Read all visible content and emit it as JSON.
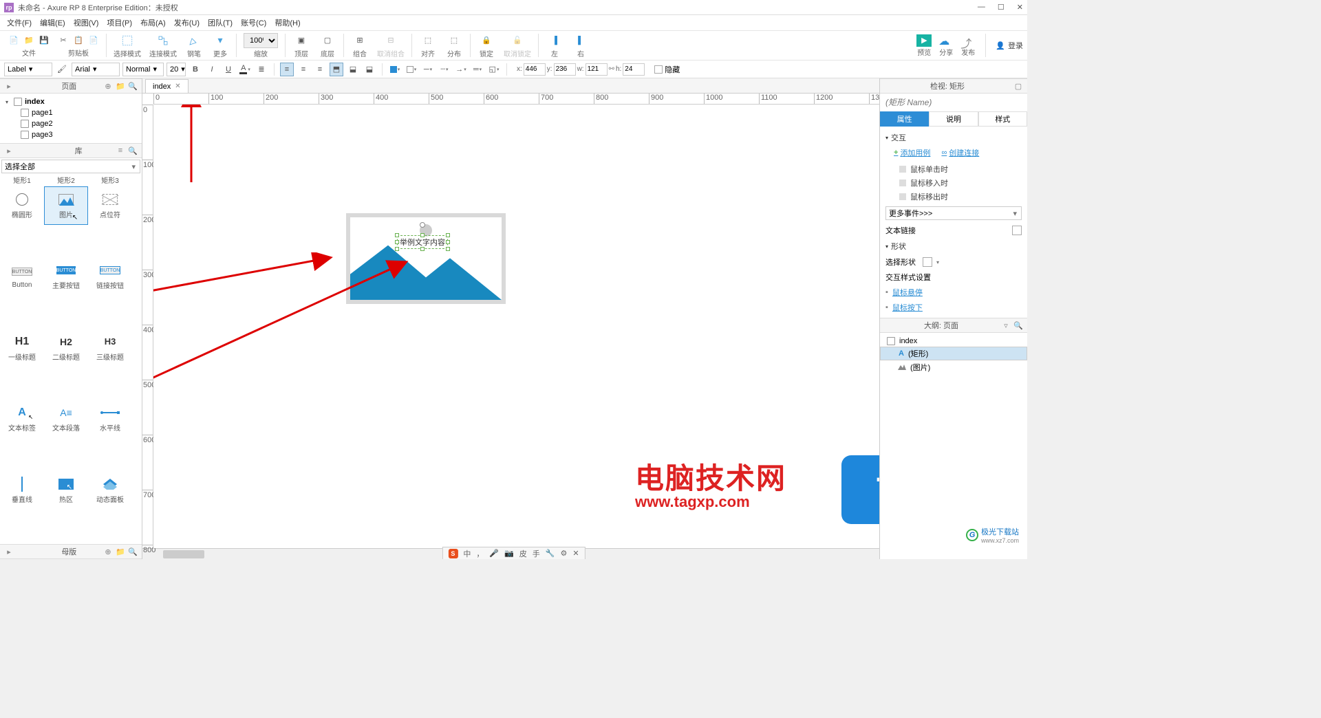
{
  "title": "未命名 - Axure RP 8 Enterprise Edition：未授权",
  "menus": [
    "文件(F)",
    "编辑(E)",
    "视图(V)",
    "项目(P)",
    "布局(A)",
    "发布(U)",
    "团队(T)",
    "账号(C)",
    "帮助(H)"
  ],
  "toolbar": {
    "group1": {
      "label": "文件"
    },
    "group2": {
      "label": "剪贴板"
    },
    "sel_mode": "选择模式",
    "conn_mode": "连接模式",
    "pen": "钢笔",
    "more": "更多",
    "zoom": "100%",
    "zoom_lbl": "缩放",
    "top": "顶层",
    "bottom": "底层",
    "group": "组合",
    "ungroup": "取消组合",
    "align": "对齐",
    "distribute": "分布",
    "lock": "锁定",
    "unlock": "取消锁定",
    "left": "左",
    "right": "右",
    "preview": "预览",
    "share": "分享",
    "publish": "发布",
    "login": "登录"
  },
  "format": {
    "label": "Label",
    "font": "Arial",
    "weight": "Normal",
    "size": "20",
    "x": "446",
    "y": "236",
    "w": "121",
    "h": "24",
    "hide": "隐藏"
  },
  "pages": {
    "title": "页面",
    "items": [
      "index",
      "page1",
      "page2",
      "page3"
    ]
  },
  "lib": {
    "title": "库",
    "select": "选择全部",
    "row0": [
      "矩形1",
      "矩形2",
      "矩形3"
    ],
    "widgets": [
      {
        "label": "椭圆形"
      },
      {
        "label": "图片"
      },
      {
        "label": "点位符"
      },
      {
        "label": "Button"
      },
      {
        "label": "主要按钮"
      },
      {
        "label": "链接按钮"
      },
      {
        "label": "一级标题"
      },
      {
        "label": "二级标题"
      },
      {
        "label": "三级标题"
      },
      {
        "label": "文本标签"
      },
      {
        "label": "文本段落"
      },
      {
        "label": "水平线"
      },
      {
        "label": "垂直线"
      },
      {
        "label": "热区"
      },
      {
        "label": "动态面板"
      }
    ],
    "h1": "H1",
    "h2": "H2",
    "h3": "H3",
    "button": "BUTTON"
  },
  "master": {
    "title": "母版"
  },
  "tab": "index",
  "canvas_text": "举例文字内容",
  "inspector": {
    "title": "检视: 矩形",
    "name_ph": "(矩形 Name)",
    "tabs": [
      "属性",
      "说明",
      "样式"
    ],
    "interact": "交互",
    "add_case": "添加用例",
    "create_link": "创建连接",
    "events": [
      "鼠标单击时",
      "鼠标移入时",
      "鼠标移出时"
    ],
    "more_events": "更多事件>>>",
    "text_link": "文本链接",
    "shape": "形状",
    "sel_shape": "选择形状",
    "ix_style": "交互样式设置",
    "hover": "鼠标悬停",
    "pressed": "鼠标按下"
  },
  "outline": {
    "title": "大纲: 页面",
    "items": [
      {
        "label": "index",
        "type": "page"
      },
      {
        "label": "(矩形)",
        "type": "shape",
        "sel": true
      },
      {
        "label": "(图片)",
        "type": "image"
      }
    ]
  },
  "watermark": {
    "t1": "电脑技术网",
    "t2": "www.tagxp.com",
    "tag": "TAG",
    "dl": "极光下载站",
    "dl_sub": "www.xz7.com"
  },
  "ime": [
    "中",
    "，",
    "🎤",
    "📷",
    "皮",
    "手",
    "🔧",
    "⚙",
    "✕"
  ]
}
